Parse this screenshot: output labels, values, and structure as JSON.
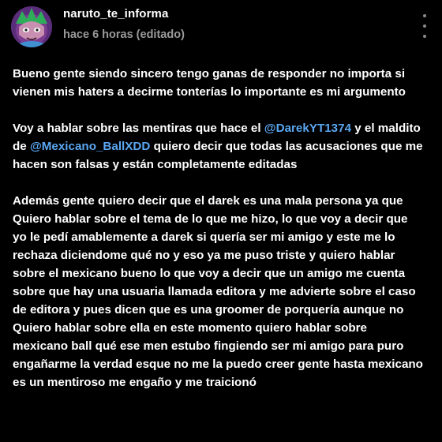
{
  "post": {
    "username": "naruto_te_informa",
    "timestamp": "hace 6 horas (editado)",
    "paragraph1": "Bueno gente siendo sincero tengo ganas de responder no importa si vienen mis haters a decirme tonterías lo importante es mi argumento",
    "paragraph2": {
      "part1": "Voy a hablar sobre las mentiras que hace el ",
      "mention1": "@DarekYT1374",
      "part2": " y el maldito de ",
      "mention2": "@Mexicano_BallXDD",
      "part3": " quiero decir que todas las acusaciones que me hacen son falsas y están completamente editadas"
    },
    "paragraph3": "Además gente quiero decir que el darek es una mala persona ya que Quiero hablar sobre el tema de lo que me hizo, lo que voy a decir que yo le pedí amablemente a darek si quería ser mi amigo y este me lo rechaza diciendome qué no y eso ya me puso triste y quiero hablar sobre el mexicano bueno lo que voy a decir que un amigo me cuenta sobre que hay una usuaria llamada editora y me advierte sobre el caso de editora y pues dicen que es una groomer de porquería aunque no Quiero hablar sobre ella en este momento quiero hablar sobre mexicano ball qué ese men estubo fingiendo ser mi amigo para puro engañarme la verdad esque no me la puedo creer gente hasta mexicano es un mentiroso me engaño y me traicionó"
  },
  "colors": {
    "background": "#000000",
    "text": "#ffffff",
    "muted": "#9a9a9a",
    "mention": "#5aa7f2"
  },
  "icons": {
    "avatar": "avatar",
    "menu": "more-vertical-icon"
  }
}
